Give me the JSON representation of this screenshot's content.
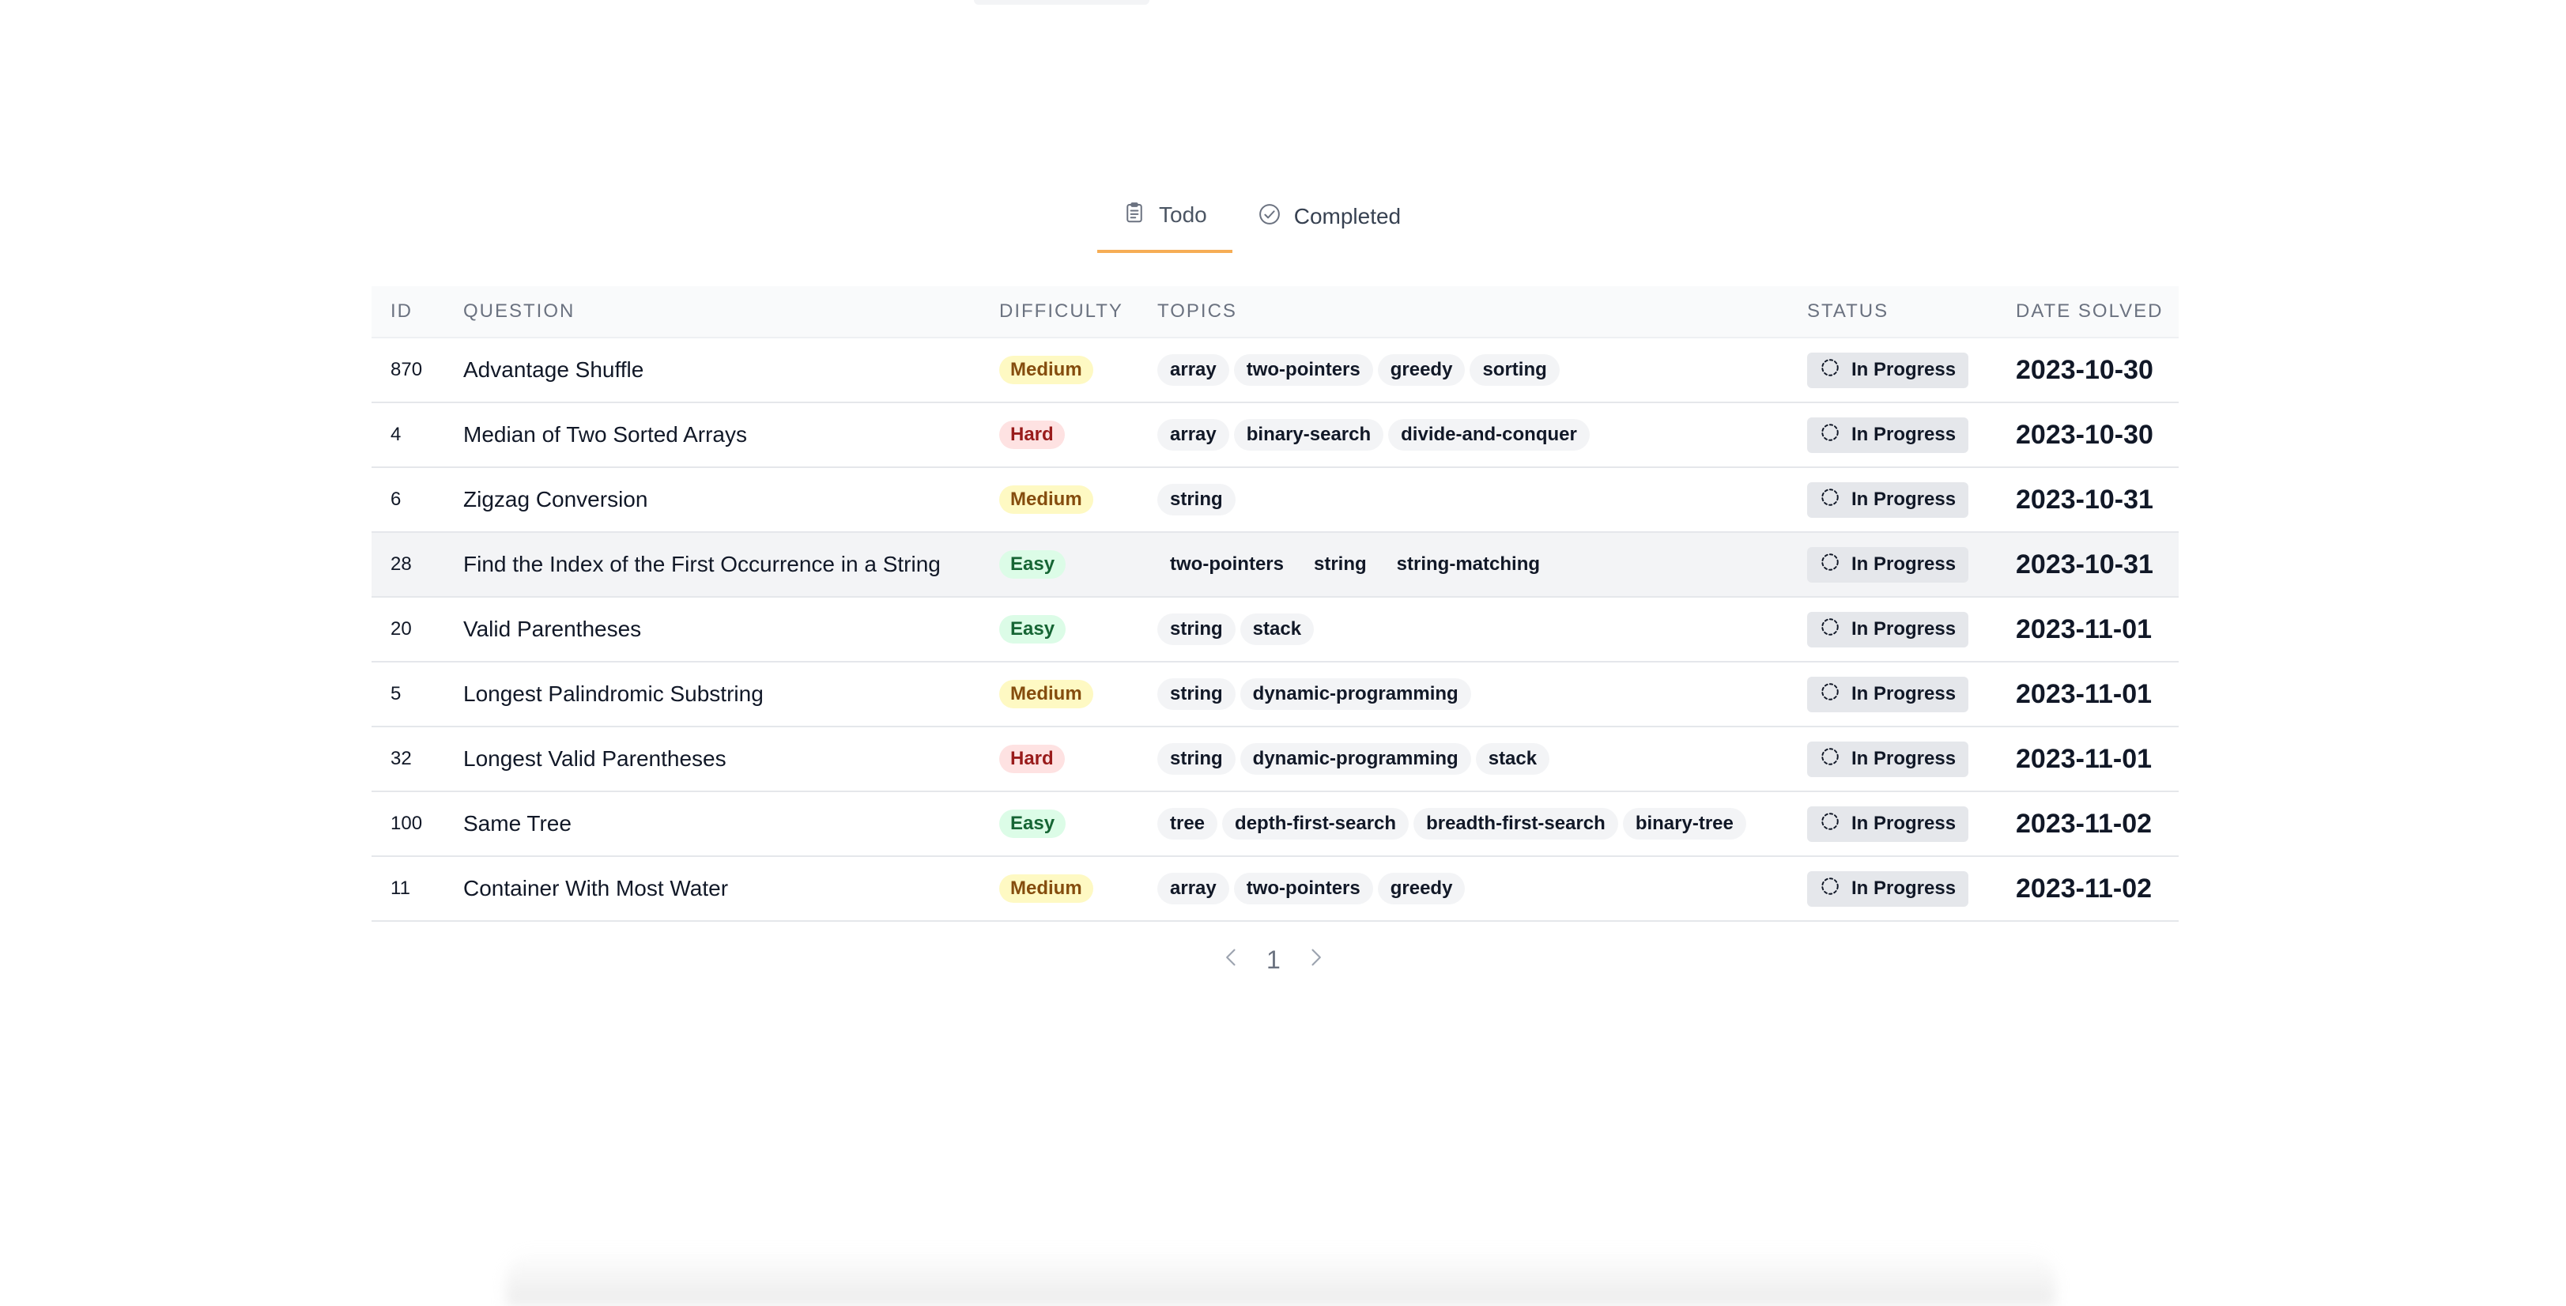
{
  "tabs": [
    {
      "label": "Todo",
      "icon": "clipboard-icon",
      "active": true
    },
    {
      "label": "Completed",
      "icon": "check-circle-icon",
      "active": false
    }
  ],
  "table": {
    "headers": [
      "ID",
      "QUESTION",
      "DIFFICULTY",
      "TOPICS",
      "STATUS",
      "DATE SOLVED"
    ],
    "rows": [
      {
        "id": "870",
        "question": "Advantage Shuffle",
        "difficulty": "Medium",
        "topics": [
          "array",
          "two-pointers",
          "greedy",
          "sorting"
        ],
        "status": "In Progress",
        "date": "2023-10-30"
      },
      {
        "id": "4",
        "question": "Median of Two Sorted Arrays",
        "difficulty": "Hard",
        "topics": [
          "array",
          "binary-search",
          "divide-and-conquer"
        ],
        "status": "In Progress",
        "date": "2023-10-30"
      },
      {
        "id": "6",
        "question": "Zigzag Conversion",
        "difficulty": "Medium",
        "topics": [
          "string"
        ],
        "status": "In Progress",
        "date": "2023-10-31"
      },
      {
        "id": "28",
        "question": "Find the Index of the First Occurrence in a String",
        "difficulty": "Easy",
        "topics": [
          "two-pointers",
          "string",
          "string-matching"
        ],
        "status": "In Progress",
        "date": "2023-10-31"
      },
      {
        "id": "20",
        "question": "Valid Parentheses",
        "difficulty": "Easy",
        "topics": [
          "string",
          "stack"
        ],
        "status": "In Progress",
        "date": "2023-11-01"
      },
      {
        "id": "5",
        "question": "Longest Palindromic Substring",
        "difficulty": "Medium",
        "topics": [
          "string",
          "dynamic-programming"
        ],
        "status": "In Progress",
        "date": "2023-11-01"
      },
      {
        "id": "32",
        "question": "Longest Valid Parentheses",
        "difficulty": "Hard",
        "topics": [
          "string",
          "dynamic-programming",
          "stack"
        ],
        "status": "In Progress",
        "date": "2023-11-01"
      },
      {
        "id": "100",
        "question": "Same Tree",
        "difficulty": "Easy",
        "topics": [
          "tree",
          "depth-first-search",
          "breadth-first-search",
          "binary-tree"
        ],
        "status": "In Progress",
        "date": "2023-11-02"
      },
      {
        "id": "11",
        "question": "Container With Most Water",
        "difficulty": "Medium",
        "topics": [
          "array",
          "two-pointers",
          "greedy"
        ],
        "status": "In Progress",
        "date": "2023-11-02"
      }
    ]
  },
  "pagination": {
    "current_page": "1"
  }
}
